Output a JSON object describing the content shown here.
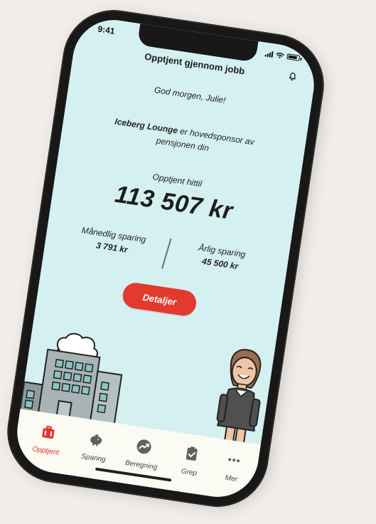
{
  "status": {
    "time": "9:41"
  },
  "header": {
    "title": "Opptjent gjennom jobb",
    "bell_icon": "bell-icon"
  },
  "greeting": "God morgen, Julie!",
  "sponsor": {
    "company": "Iceberg Lounge",
    "line1_rest": " er hovedsponsor av",
    "line2": "pensjonen din"
  },
  "earnings": {
    "label": "Opptjent hittil",
    "amount": "113 507 kr"
  },
  "summary": {
    "monthly_label": "Månedlig sparing",
    "monthly_value": "3 791 kr",
    "yearly_label": "Årlig sparing",
    "yearly_value": "45 500 kr"
  },
  "actions": {
    "details_label": "Detaljer"
  },
  "tabs": [
    {
      "label": "Opptjent",
      "icon": "briefcase-icon",
      "active": true
    },
    {
      "label": "Sparing",
      "icon": "piggy-bank-icon",
      "active": false
    },
    {
      "label": "Beregning",
      "icon": "trend-chart-icon",
      "active": false
    },
    {
      "label": "Grep",
      "icon": "clipboard-check-icon",
      "active": false
    },
    {
      "label": "Mer",
      "icon": "more-dots-icon",
      "active": false
    }
  ],
  "colors": {
    "background": "#f2ede9",
    "screen": "#d5f0f1",
    "accent": "#e33a2f",
    "grass": "#9ad64e",
    "tabbar": "#fbfaf3"
  }
}
